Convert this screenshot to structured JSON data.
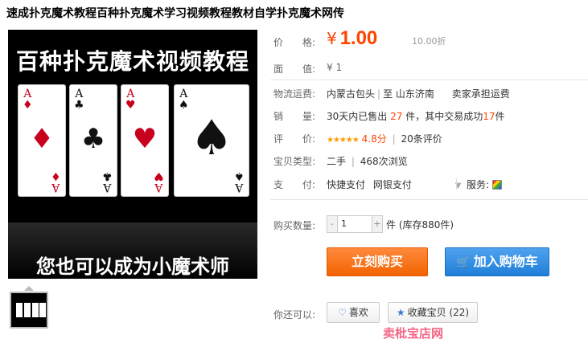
{
  "product": {
    "title": "速成扑克魔术教程百种扑克魔术学习视频教程教材自学扑克魔术网传",
    "image_top_text": "百种扑克魔术视频教程",
    "image_bottom_text": "您也可以成为小魔术师"
  },
  "price": {
    "label": "价　　格:",
    "currency": "¥",
    "value": "1.00",
    "discount": "10.00折"
  },
  "face_value": {
    "label": "面　　值:",
    "value": "¥ 1"
  },
  "shipping": {
    "label": "物流运费:",
    "from": "内蒙古包头",
    "separator": "|",
    "to_prefix": "至",
    "to": "山东济南",
    "fee": "卖家承担运费"
  },
  "sales": {
    "label": "销　　量:",
    "prefix": "30天内已售出",
    "sold": "27",
    "middle": "件，其中交易成功",
    "success": "17",
    "suffix": "件"
  },
  "rating": {
    "label": "评　　价:",
    "stars": "★★★★★",
    "score": "4.8分",
    "separator": "|",
    "reviews": "20条评价"
  },
  "condition": {
    "label": "宝贝类型:",
    "value": "二手",
    "separator": "|",
    "views": "468次浏览"
  },
  "payment": {
    "label": "支　　付:",
    "method1": "快捷支付",
    "method2": "网银支付",
    "dropdown": "▼",
    "service_label": "服务:"
  },
  "quantity": {
    "label": "购买数量:",
    "minus": "-",
    "value": "1",
    "plus": "+",
    "unit": "件 (库存880件)"
  },
  "actions": {
    "buy_now": "立刻购买",
    "add_to_cart": "加入购物车",
    "cart_icon": "🛒"
  },
  "social": {
    "label": "你还可以:",
    "like": "喜欢",
    "favorite": "收藏宝贝 (22)"
  },
  "watermark": "卖枇宝店网"
}
